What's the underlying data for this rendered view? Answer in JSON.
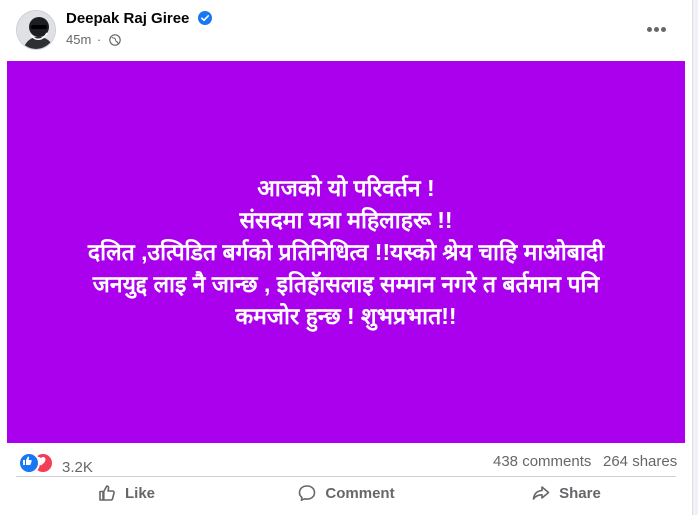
{
  "post": {
    "author": "Deepak Raj Giree",
    "time": "45m",
    "separator": "·",
    "text_lines": [
      "आजको यो परिवर्तन !",
      "संसदमा यत्रा महिलाहरू !!",
      "दलित ,उत्पिडित बर्गको प्रतिनिधित्व !!यस्को श्रेय चाहि माओबादी",
      "जनयुद्द लाइ नै जान्छ , इतिहॅासलाइ सम्मान नगरे त बर्तमान पनि",
      "कमजोर हुन्छ ! शुभप्रभात!!"
    ],
    "background_color": "#aa00ee",
    "text_color": "#ffffff"
  },
  "stats": {
    "reaction_count": "3.2K",
    "comments": "438 comments",
    "shares": "264 shares"
  },
  "actions": {
    "like": "Like",
    "comment": "Comment",
    "share": "Share"
  },
  "icons": {
    "verified": "verified-badge-icon",
    "audience": "globe-icon",
    "more": "more-options-icon",
    "reactions": [
      "like-reaction-icon",
      "love-reaction-icon"
    ]
  },
  "colors": {
    "brand": "#1877f2",
    "muted": "#65676b"
  }
}
